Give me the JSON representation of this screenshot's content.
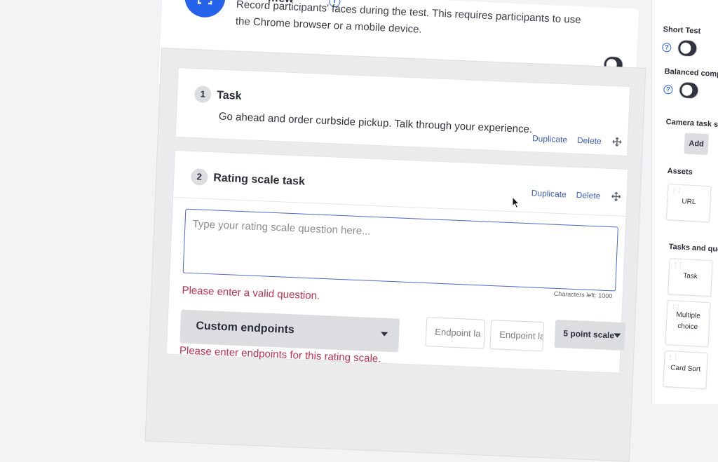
{
  "recording": {
    "title": "…ew",
    "description": "Record participants' faces during the test. This requires participants to use the Chrome browser or a mobile device."
  },
  "tasks": [
    {
      "number": "1",
      "title": "Task",
      "body": "Go ahead and order curbside pickup. Talk through your experience.",
      "duplicate_label": "Duplicate",
      "delete_label": "Delete"
    },
    {
      "number": "2",
      "title": "Rating scale task",
      "duplicate_label": "Duplicate",
      "delete_label": "Delete",
      "question_placeholder": "Type your rating scale question here...",
      "characters_left": "Characters left: 1000",
      "question_error": "Please enter a valid question.",
      "endpoints_select": "Custom endpoints",
      "endpoint_placeholder_1": "Endpoint la",
      "endpoint_placeholder_2": "Endpoint la",
      "scale_select": "5 point scale",
      "endpoints_error": "Please enter endpoints for this rating scale."
    }
  ],
  "sidebar": {
    "short_test_label": "Short Test",
    "balanced_label": "Balanced comparis",
    "camera_label": "Camera task sectio",
    "add_label": "Add",
    "assets_label": "Assets",
    "asset_tiles": [
      "URL"
    ],
    "tasks_label": "Tasks and questio",
    "task_tiles": [
      "Task",
      "Multiple choice",
      "Card Sort"
    ]
  },
  "colors": {
    "accent": "#2563eb",
    "error": "#c2304f",
    "link": "#3b5bbf"
  }
}
